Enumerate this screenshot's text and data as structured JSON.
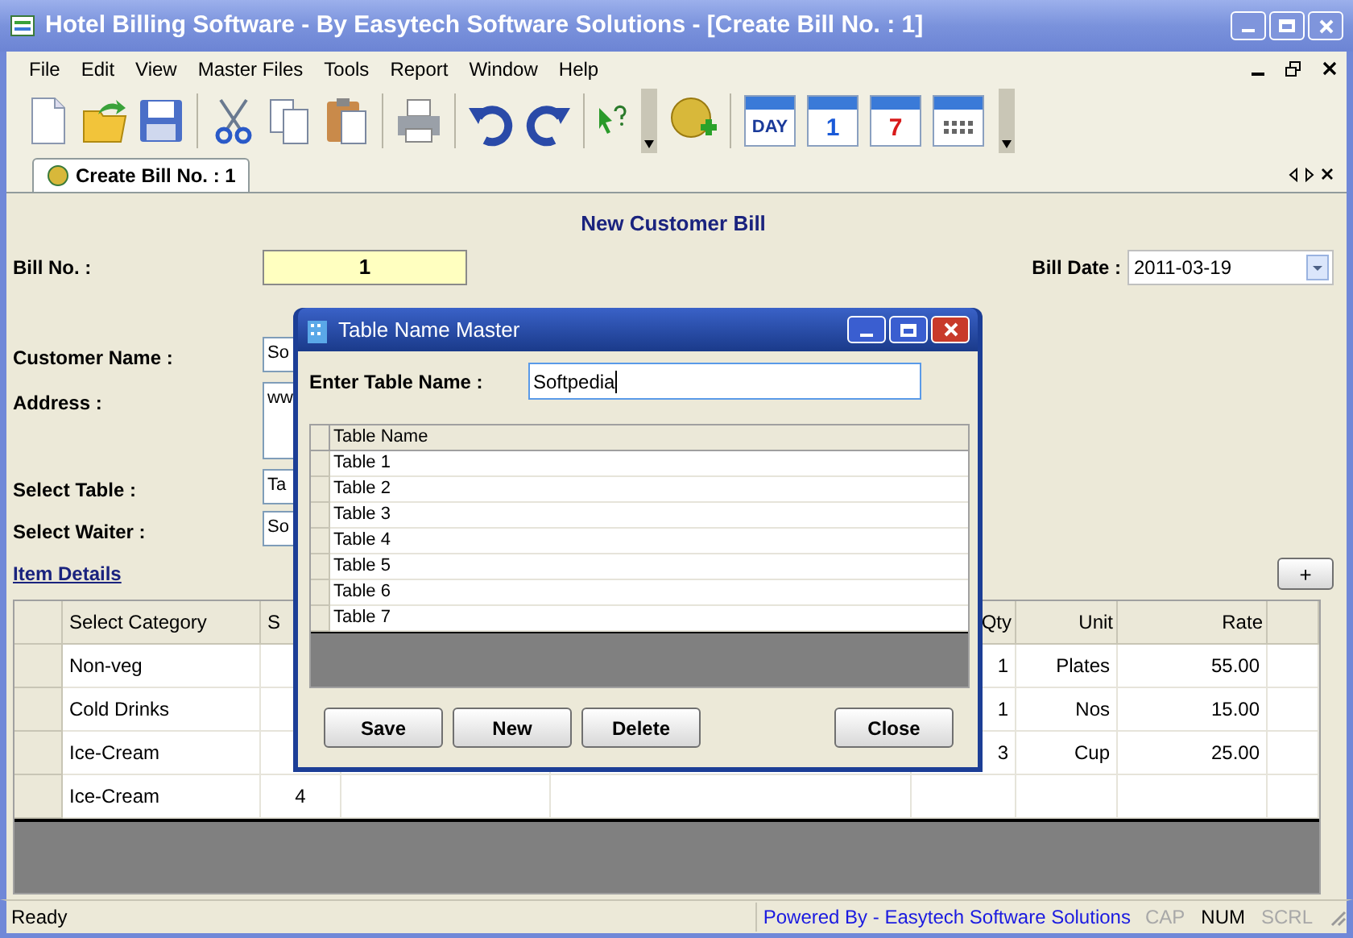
{
  "window": {
    "title": "Hotel Billing Software - By Easytech Software Solutions - [Create Bill No. : 1]"
  },
  "menu": [
    "File",
    "Edit",
    "View",
    "Master Files",
    "Tools",
    "Report",
    "Window",
    "Help"
  ],
  "toolbar": [
    {
      "kind": "new"
    },
    {
      "kind": "open"
    },
    {
      "kind": "save"
    },
    {
      "kind": "sep"
    },
    {
      "kind": "cut"
    },
    {
      "kind": "copy"
    },
    {
      "kind": "paste"
    },
    {
      "kind": "sep"
    },
    {
      "kind": "print"
    },
    {
      "kind": "sep"
    },
    {
      "kind": "undo"
    },
    {
      "kind": "redo"
    },
    {
      "kind": "sep"
    },
    {
      "kind": "help"
    },
    {
      "kind": "grip"
    },
    {
      "kind": "coin"
    },
    {
      "kind": "sep"
    },
    {
      "kind": "calendar",
      "label": "DAY"
    },
    {
      "kind": "calendar",
      "label": "1"
    },
    {
      "kind": "calendar",
      "label": "7"
    },
    {
      "kind": "calendar"
    },
    {
      "kind": "grip"
    }
  ],
  "tabs": [
    {
      "label": "Create Bill No. : 1",
      "selected": true
    }
  ],
  "form": {
    "heading": "New Customer Bill",
    "bill_no": {
      "label": "Bill No. :",
      "value": "1"
    },
    "bill_date": {
      "label": "Bill Date :",
      "value": "2011-03-19"
    },
    "customer_name": {
      "label": "Customer Name :",
      "value": "So"
    },
    "address": {
      "label": "Address :",
      "value": "ww"
    },
    "select_table": {
      "label": "Select Table :",
      "value": "Ta"
    },
    "select_waiter": {
      "label": "Select Waiter :",
      "value": "So"
    },
    "item_details_link": "Item Details",
    "add_button": "+"
  },
  "items_table": {
    "columns": [
      {
        "label": "Select Category"
      },
      {
        "label": "S"
      },
      {},
      {},
      {
        "label": "Qty"
      },
      {
        "label": "Unit"
      },
      {
        "label": "Rate"
      },
      {}
    ],
    "rows": [
      {
        "cells": [
          "Non-veg",
          "",
          "",
          "",
          "1",
          "Plates",
          "55.00",
          ""
        ]
      },
      {
        "cells": [
          "Cold Drinks",
          "",
          "",
          "",
          "1",
          "Nos",
          "15.00",
          ""
        ]
      },
      {
        "cells": [
          "Ice-Cream",
          "",
          "",
          "",
          "3",
          "Cup",
          "25.00",
          ""
        ]
      },
      {
        "cells": [
          "Ice-Cream",
          "4",
          "",
          "",
          "",
          "",
          "",
          ""
        ]
      }
    ]
  },
  "dialog": {
    "title": "Table Name Master",
    "field_label": "Enter Table Name :",
    "field_value": "Softpedia",
    "column": "Table Name",
    "rows": [
      "Table 1",
      "Table 2",
      "Table 3",
      "Table 4",
      "Table 5",
      "Table 6",
      "Table 7"
    ],
    "buttons": [
      "Save",
      "New",
      "Delete"
    ],
    "close_button": "Close"
  },
  "status_bar": {
    "text": "Ready",
    "powered_by": "Powered By - Easytech Software Solutions",
    "indicators": [
      {
        "label": "CAP",
        "on": false
      },
      {
        "label": "NUM",
        "on": true
      },
      {
        "label": "SCRL",
        "on": false
      }
    ]
  }
}
